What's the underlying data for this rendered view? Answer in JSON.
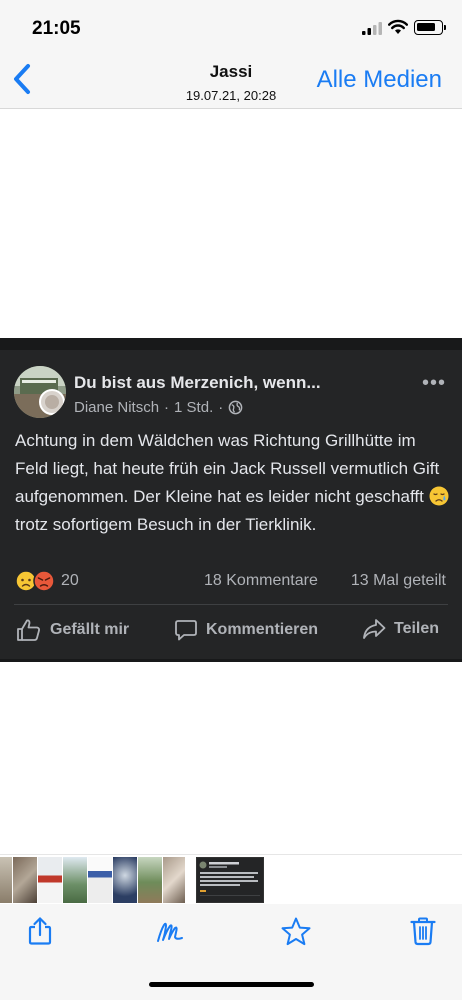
{
  "status_bar": {
    "time": "21:05"
  },
  "nav": {
    "title": "Jassi",
    "subtitle": "19.07.21, 20:28",
    "all_media_label": "Alle Medien",
    "back_icon": "chevron-left-icon"
  },
  "post": {
    "group_name": "Du bist aus Merzenich, wenn...",
    "author": "Diane Nitsch",
    "time": "1 Std.",
    "separator": "·",
    "text_before_emoji": "Achtung in dem Wäldchen was Richtung Grillhütte im Feld liegt, hat heute früh ein Jack Russell vermutlich Gift aufgenommen. Der Kleine hat es leider nicht geschafft ",
    "text_after_emoji": " trotz sofortigem Besuch in der Tierklinik.",
    "reaction_count": "20",
    "comments": "18 Kommentare",
    "shares": "13 Mal geteilt",
    "actions": {
      "like": "Gefällt mir",
      "comment": "Kommentieren",
      "share": "Teilen"
    }
  },
  "colors": {
    "accent": "#1a7cf3",
    "post_bg": "#242526",
    "post_text": "#e4e6eb",
    "muted_text": "#b0b3b8"
  },
  "toolbar": {
    "icons": [
      "share-icon",
      "markup-icon",
      "favorite-star-icon",
      "trash-icon"
    ]
  }
}
